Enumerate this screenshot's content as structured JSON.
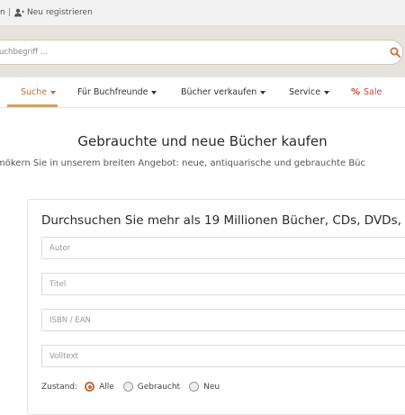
{
  "topbar": {
    "login_label": "n",
    "separator": "|",
    "register_label": "Neu registrieren"
  },
  "search": {
    "placeholder": "uchbegriff ..."
  },
  "nav": {
    "items": [
      {
        "label": "Suche",
        "active": true
      },
      {
        "label": "Für Buchfreunde"
      },
      {
        "label": "Bücher verkaufen"
      },
      {
        "label": "Service"
      },
      {
        "label": "Sale"
      }
    ],
    "sale_icon": "%"
  },
  "main": {
    "title": "Gebrauchte und neue Bücher kaufen",
    "subtitle": "mökern Sie in unserem breiten Angebot: neue, antiquarische und gebrauchte Büc"
  },
  "form": {
    "heading": "Durchsuchen Sie mehr als 19 Millionen Bücher, CDs, DVDs, ...",
    "fields": [
      {
        "placeholder": "Autor"
      },
      {
        "placeholder": "Titel"
      },
      {
        "placeholder": "ISBN / EAN"
      },
      {
        "placeholder": "Volltext"
      }
    ],
    "zustand": {
      "label": "Zustand:",
      "options": [
        {
          "label": "Alle",
          "selected": true
        },
        {
          "label": "Gebraucht",
          "selected": false
        },
        {
          "label": "Neu",
          "selected": false
        }
      ]
    }
  },
  "colors": {
    "accent": "#c76b3a",
    "sale": "#d0452f",
    "search_band": "#e5e3dc",
    "top_bar": "#f2f2f2"
  }
}
